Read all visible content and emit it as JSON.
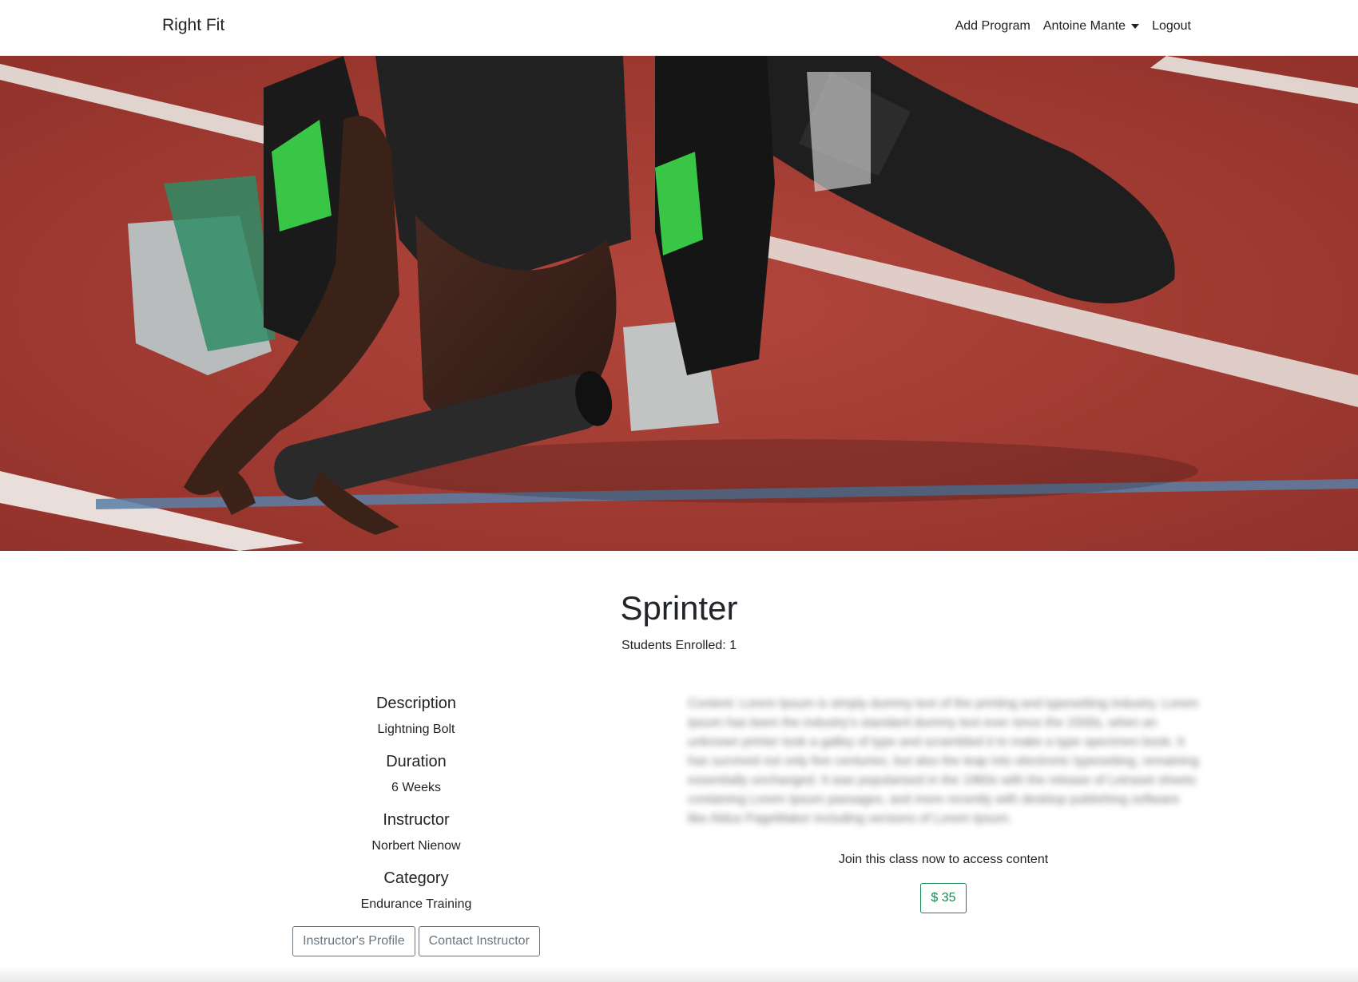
{
  "navbar": {
    "brand": "Right Fit",
    "add_program": "Add Program",
    "user_name": "Antoine Mante",
    "logout": "Logout"
  },
  "program": {
    "title": "Sprinter",
    "students_enrolled": "Students Enrolled: 1"
  },
  "details": {
    "description_heading": "Description",
    "description_value": "Lightning Bolt",
    "duration_heading": "Duration",
    "duration_value": "6 Weeks",
    "instructor_heading": "Instructor",
    "instructor_value": "Norbert Nienow",
    "category_heading": "Category",
    "category_value": "Endurance Training"
  },
  "buttons": {
    "instructor_profile": "Instructor's Profile",
    "contact_instructor": "Contact Instructor"
  },
  "content": {
    "blurred_text": "Content: Lorem Ipsum is simply dummy text of the printing and typesetting industry. Lorem Ipsum has been the industry's standard dummy text ever since the 1500s, when an unknown printer took a galley of type and scrambled it to make a type specimen book. It has survived not only five centuries, but also the leap into electronic typesetting, remaining essentially unchanged. It was popularised in the 1960s with the release of Letraset sheets containing Lorem Ipsum passages, and more recently with desktop publishing software like Aldus PageMaker including versions of Lorem Ipsum.",
    "join_text": "Join this class now to access content",
    "price_label": "$ 35"
  },
  "colors": {
    "track": "#a03b33",
    "success": "#198754",
    "secondary": "#6c757d"
  }
}
